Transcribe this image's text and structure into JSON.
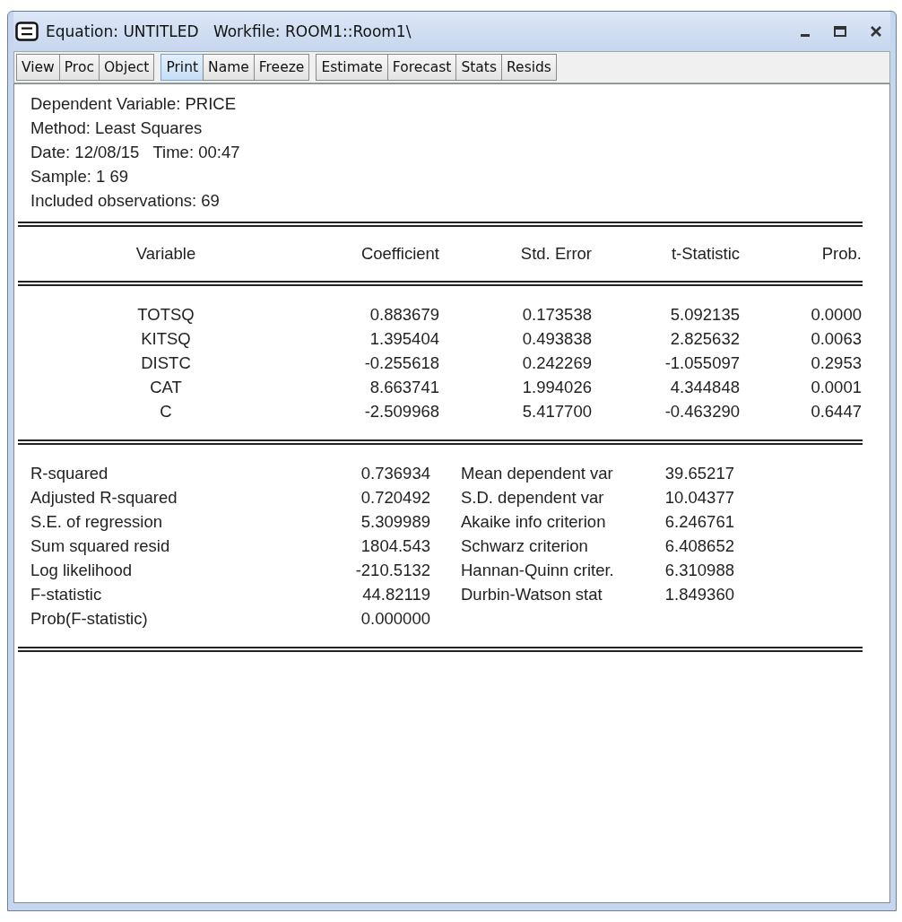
{
  "window": {
    "title": "Equation: UNTITLED   Workfile: ROOM1::Room1\\"
  },
  "toolbar": {
    "groups": [
      [
        {
          "label": "View",
          "selected": false
        },
        {
          "label": "Proc",
          "selected": false
        },
        {
          "label": "Object",
          "selected": false
        }
      ],
      [
        {
          "label": "Print",
          "selected": true
        },
        {
          "label": "Name",
          "selected": false
        },
        {
          "label": "Freeze",
          "selected": false
        }
      ],
      [
        {
          "label": "Estimate",
          "selected": false
        },
        {
          "label": "Forecast",
          "selected": false
        },
        {
          "label": "Stats",
          "selected": false
        },
        {
          "label": "Resids",
          "selected": false
        }
      ]
    ]
  },
  "header_lines": [
    "Dependent Variable: PRICE",
    "Method: Least Squares",
    "Date: 12/08/15   Time: 00:47",
    "Sample: 1 69",
    "Included observations: 69"
  ],
  "table": {
    "columns": [
      "Variable",
      "Coefficient",
      "Std. Error",
      "t-Statistic",
      "Prob."
    ],
    "rows": [
      [
        "TOTSQ",
        "0.883679",
        "0.173538",
        "5.092135",
        "0.0000"
      ],
      [
        "KITSQ",
        "1.395404",
        "0.493838",
        "2.825632",
        "0.0063"
      ],
      [
        "DISTC",
        "-0.255618",
        "0.242269",
        "-1.055097",
        "0.2953"
      ],
      [
        "CAT",
        "8.663741",
        "1.994026",
        "4.344848",
        "0.0001"
      ],
      [
        "C",
        "-2.509968",
        "5.417700",
        "-0.463290",
        "0.6447"
      ]
    ]
  },
  "statistics": [
    [
      "R-squared",
      "0.736934",
      "Mean dependent var",
      "39.65217"
    ],
    [
      "Adjusted R-squared",
      "0.720492",
      "S.D. dependent var",
      "10.04377"
    ],
    [
      "S.E. of regression",
      "5.309989",
      "Akaike info criterion",
      "6.246761"
    ],
    [
      "Sum squared resid",
      "1804.543",
      "Schwarz criterion",
      "6.408652"
    ],
    [
      "Log likelihood",
      "-210.5132",
      "Hannan-Quinn criter.",
      "6.310988"
    ],
    [
      "F-statistic",
      "44.82119",
      "Durbin-Watson stat",
      "1.849360"
    ],
    [
      "Prob(F-statistic)",
      "0.000000"
    ]
  ]
}
